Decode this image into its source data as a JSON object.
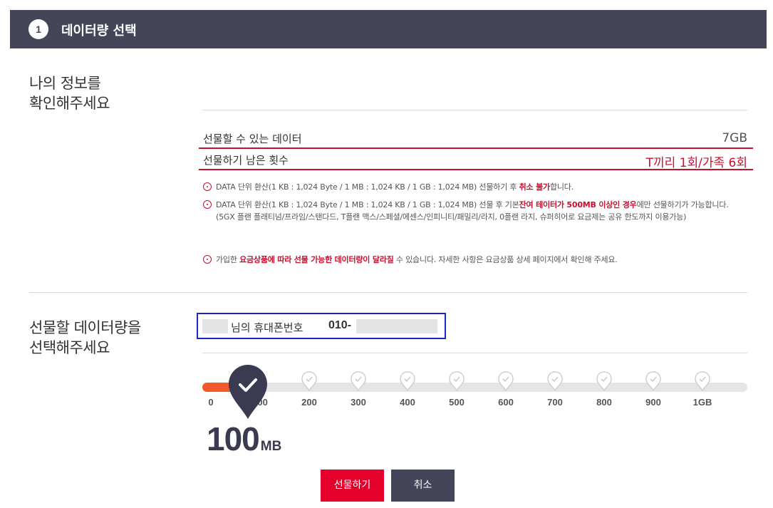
{
  "header": {
    "step": "1",
    "title": "데이터량 선택"
  },
  "section1": {
    "title": "나의 정보를\n확인해주세요"
  },
  "info": {
    "giftable_label": "선물할 수 있는 데이터",
    "giftable_value": "7GB",
    "remaining_label": "선물하기 남은 횟수",
    "remaining_value": "T끼리 1회/가족 6회"
  },
  "notes": {
    "n1_pre": "DATA 단위 환산(1 KB : 1,024 Byte / 1 MB : 1,024 KB / 1 GB : 1,024 MB) 선물하기 후 ",
    "n1_em": "취소 불가",
    "n1_post": "합니다.",
    "n2_pre": "DATA 단위 환산(1 KB : 1,024 Byte / 1 MB : 1,024 KB / 1 GB : 1,024 MB) 선물 후 기본",
    "n2_em": "잔여 테이터가 500MB 이상인 경우",
    "n2_post": "에만 선물하기가 가능합니다.",
    "n2_sub": "(5GX 플랜 플래티넘/프라임/스탠다드, T플랜 맥스/스페셜/에센스/인피니티/패밀리/라지, 0플랜 라지, 슈퍼히어로 요금제는 공유 한도까지 이용가능)",
    "n3_pre": "가입한 ",
    "n3_em": "요금상품에 따라 선물 가능한 데이터량이 달라질",
    "n3_post": " 수 있습니다. 자세한 사항은 요금상품 상세 페이지에서 확인해 주세요."
  },
  "section2": {
    "title": "선물할 데이터량을\n선택해주세요"
  },
  "phone": {
    "label": "님의 휴대폰번호",
    "prefix": "010-"
  },
  "slider": {
    "ticks": [
      "0",
      "100",
      "200",
      "300",
      "400",
      "500",
      "600",
      "700",
      "800",
      "900",
      "1GB"
    ],
    "selected_index": 1,
    "accent_color": "#f05a28",
    "marker_icon": "check-icon"
  },
  "amount": {
    "value": "100",
    "unit": "MB"
  },
  "buttons": {
    "gift": "선물하기",
    "cancel": "취소"
  },
  "colors": {
    "header_bg": "#45455a",
    "highlight_red": "#c8102e",
    "gift_button": "#e4002b",
    "phone_box_border": "#1a26c8"
  }
}
